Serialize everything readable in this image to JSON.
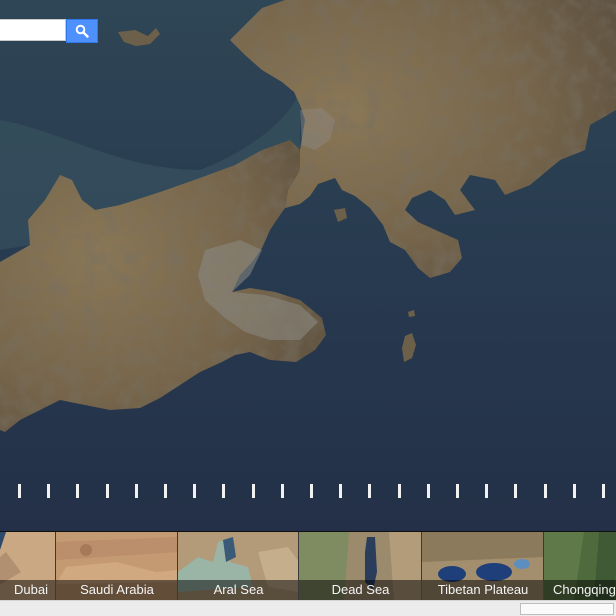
{
  "search": {
    "placeholder": "",
    "button_icon": "search-icon"
  },
  "timeline": {
    "tick_count": 21
  },
  "places": [
    {
      "label": "Dubai"
    },
    {
      "label": "Saudi Arabia"
    },
    {
      "label": "Aral Sea"
    },
    {
      "label": "Dead Sea"
    },
    {
      "label": "Tibetan Plateau"
    },
    {
      "label": "Chongqing"
    }
  ],
  "colors": {
    "sea": "#263449",
    "land": "#7f6d52",
    "search_button": "#4d90fe"
  }
}
